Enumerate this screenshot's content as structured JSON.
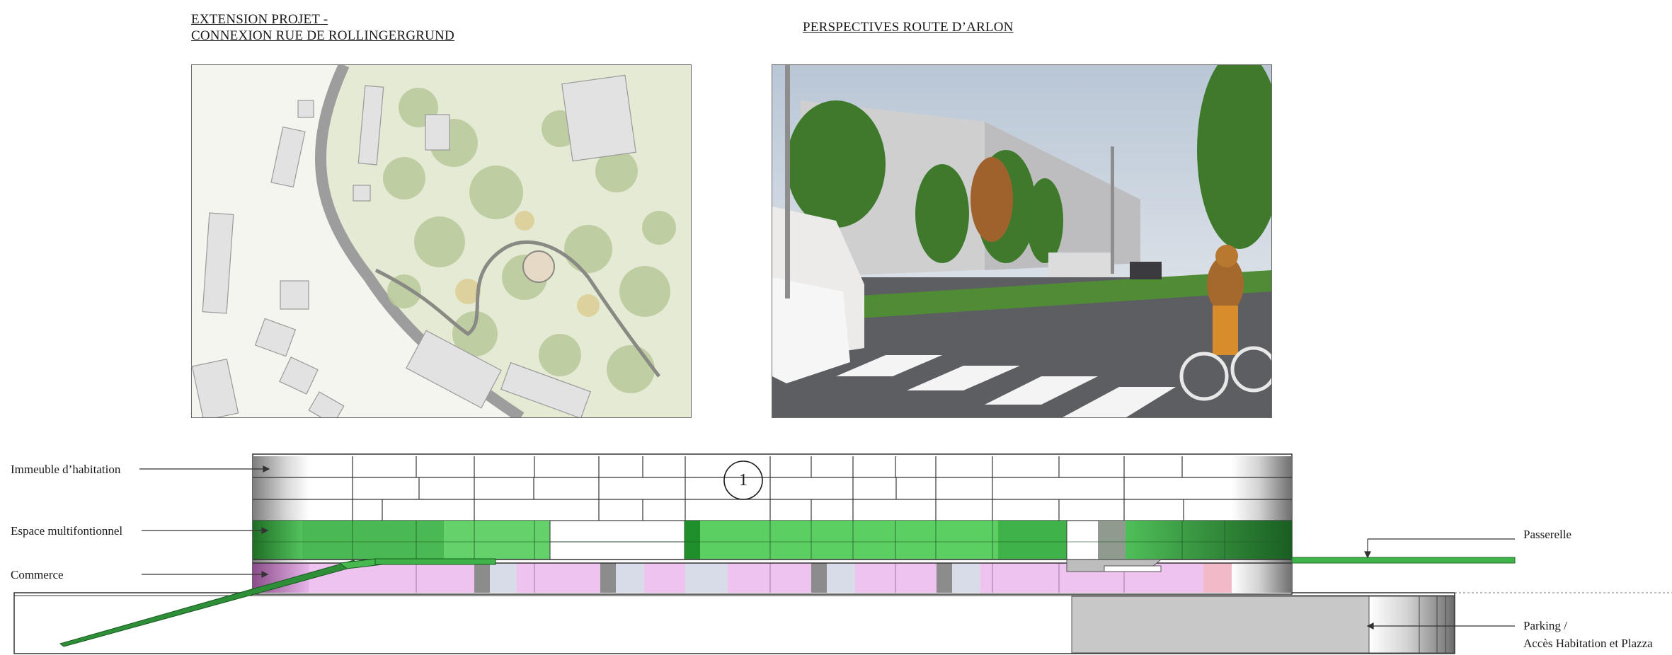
{
  "headings": {
    "left_line1": "EXTENSION PROJET -",
    "left_line2": "CONNEXION RUE DE ROLLINGERGRUND",
    "right": "PERSPECTIVES ROUTE D’ARLON"
  },
  "section": {
    "marker": "1",
    "labels": {
      "housing": "Immeuble d’habitation",
      "multifunction": "Espace multifontionnel",
      "commerce": "Commerce",
      "footbridge": "Passerelle",
      "parking_line1": "Parking /",
      "parking_line2": "Accès Habitation et Plazza"
    }
  },
  "colors": {
    "green": "#3fb24a",
    "dark_green": "#1f7a2a",
    "pink": "#e6b3e8",
    "grey": "#c8c8c8"
  }
}
